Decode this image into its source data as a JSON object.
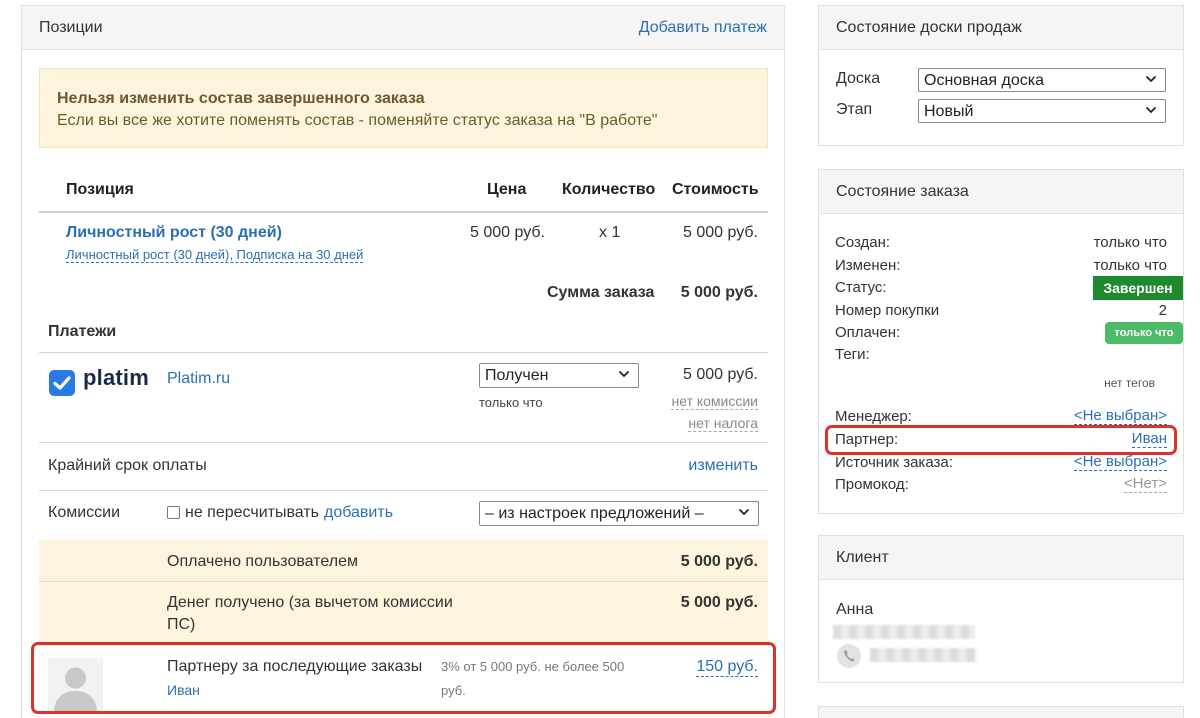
{
  "positions_panel": {
    "title": "Позиции",
    "add_payment": "Добавить платеж"
  },
  "warning": {
    "title": "Нельзя изменить состав завершенного заказа",
    "text": "Если вы все же хотите поменять состав - поменяйте статус заказа на \"В работе\""
  },
  "table": {
    "headers": {
      "position": "Позиция",
      "price": "Цена",
      "quantity": "Количество",
      "cost": "Стоимость"
    },
    "item": {
      "name": "Личностный рост (30 дней)",
      "subtitle": "Личностный рост (30 дней), Подписка на 30 дней",
      "price": "5 000 руб.",
      "quantity": "x 1",
      "cost": "5 000 руб."
    },
    "total_label": "Сумма заказа",
    "total_value": "5 000 руб."
  },
  "payments": {
    "title": "Платежи",
    "logo_text": "platim",
    "provider": "Platim.ru",
    "status_selected": "Получен",
    "status_time": "только что",
    "amount": "5 000 руб.",
    "commission": "нет комиссии",
    "tax": "нет налога"
  },
  "deadline": {
    "label": "Крайний срок оплаты",
    "action": "изменить"
  },
  "commissions": {
    "label": "Комиссии",
    "checkbox_label": "не пересчитывать",
    "add": "добавить",
    "select_selected": "– из настроек предложений –"
  },
  "summary": {
    "paid_label": "Оплачено пользователем",
    "paid_value": "5 000 руб.",
    "received_label_line1": "Денег получено (за вычетом комиссии",
    "received_label_line2": "ПС)",
    "received_value": "5 000 руб."
  },
  "partner_row": {
    "title": "Партнеру за последующие заказы",
    "partner": "Иван",
    "rule_line1": "3% от 5 000 руб. не более 500",
    "rule_line2": "руб.",
    "amount": "150 руб."
  },
  "sales_board": {
    "title": "Состояние доски продаж",
    "board_label": "Доска",
    "board_value": "Основная доска",
    "stage_label": "Этап",
    "stage_value": "Новый"
  },
  "order_state": {
    "title": "Состояние заказа",
    "created_label": "Создан:",
    "created_value": "только что",
    "changed_label": "Изменен:",
    "changed_value": "только что",
    "status_label": "Статус:",
    "status_value": "Завершен",
    "purchase_no_label": "Номер покупки",
    "purchase_no_value": "2",
    "paid_label": "Оплачен:",
    "paid_value": "только что",
    "tags_label": "Теги:",
    "tags_value": "нет тегов",
    "manager_label": "Менеджер:",
    "manager_value": "<Не выбран>",
    "partner_label": "Партнер:",
    "partner_value": "Иван",
    "source_label": "Источник заказа:",
    "source_value": "<Не выбран>",
    "promo_label": "Промокод:",
    "promo_value": "<Нет>",
    "colors": {
      "status_badge": "#1e8a2d",
      "paid_badge": "#4cba67",
      "highlight": "#d9342b"
    }
  },
  "client": {
    "title": "Клиент",
    "name": "Анна"
  }
}
